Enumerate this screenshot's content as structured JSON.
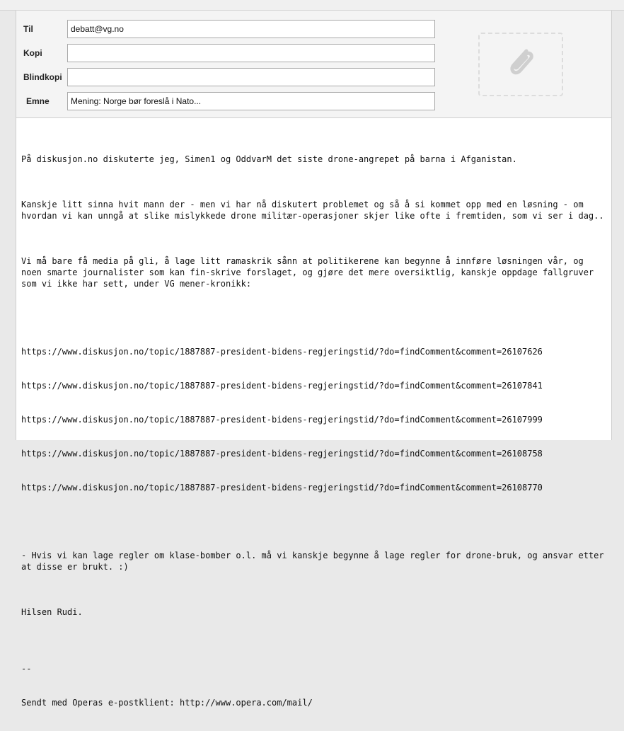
{
  "fields": {
    "to_label": "Til",
    "to_value": "debatt@vg.no",
    "cc_label": "Kopi",
    "cc_value": "",
    "bcc_label": "Blindkopi",
    "bcc_value": "",
    "subject_label": "Emne",
    "subject_value": "Mening: Norge bør foreslå i Nato..."
  },
  "attachment": {
    "icon": "paperclip-icon"
  },
  "message": {
    "paragraphs": [
      "På diskusjon.no diskuterte jeg, Simen1 og OddvarM det siste drone-angrepet på barna i Afganistan.",
      "Kanskje litt sinna hvit mann der - men vi har nå diskutert problemet og så å si kommet opp med en løsning - om hvordan vi kan unngå at slike mislykkede drone militær-operasjoner skjer like ofte i fremtiden, som vi ser i dag..",
      "Vi må bare få media på gli, å lage litt ramaskrik sånn at politikerene kan begynne å innføre løsningen vår, og noen smarte journalister som kan fin-skrive forslaget, og gjøre det mere oversiktlig, kanskje oppdage fallgruver som vi ikke har sett, under VG mener-kronikk:"
    ],
    "links": [
      "https://www.diskusjon.no/topic/1887887-president-bidens-regjeringstid/?do=findComment&comment=26107626",
      "https://www.diskusjon.no/topic/1887887-president-bidens-regjeringstid/?do=findComment&comment=26107841",
      "https://www.diskusjon.no/topic/1887887-president-bidens-regjeringstid/?do=findComment&comment=26107999",
      "https://www.diskusjon.no/topic/1887887-president-bidens-regjeringstid/?do=findComment&comment=26108758",
      "https://www.diskusjon.no/topic/1887887-president-bidens-regjeringstid/?do=findComment&comment=26108770"
    ],
    "closing": "- Hvis vi kan lage regler om klase-bomber o.l. må vi kanskje begynne å lage regler for drone-bruk, og ansvar etter at disse er brukt. :)",
    "greeting": "Hilsen Rudi.",
    "sig_sep": "--",
    "signature": "Sendt med Operas e-postklient: http://www.opera.com/mail/"
  }
}
